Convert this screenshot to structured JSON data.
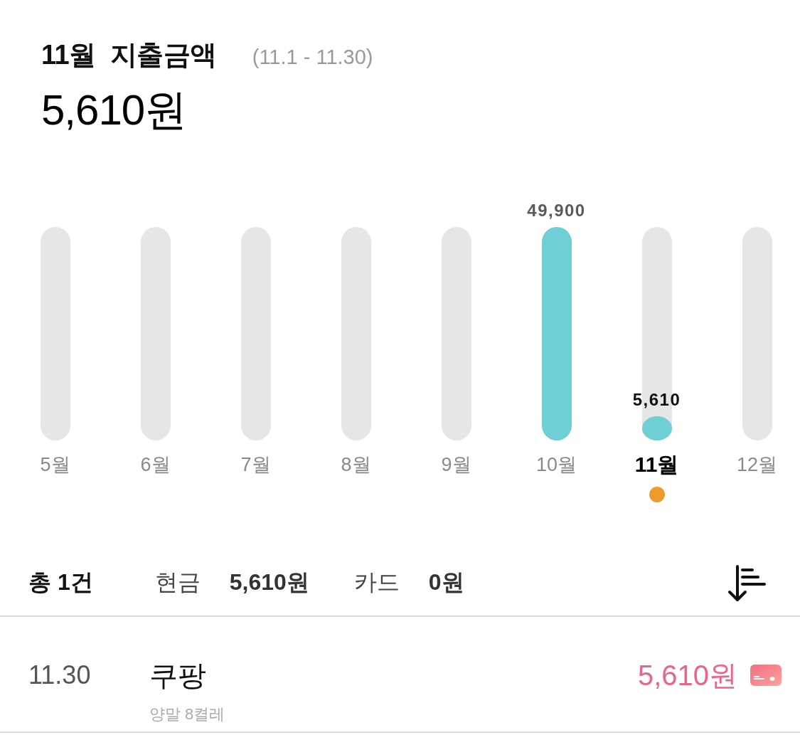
{
  "header": {
    "title": "11월 지출금액",
    "period": "(11.1 - 11.30)",
    "total": "5,610원"
  },
  "months": [
    {
      "label": "5월",
      "selected": false,
      "current": false
    },
    {
      "label": "6월",
      "selected": false,
      "current": false
    },
    {
      "label": "7월",
      "selected": false,
      "current": false
    },
    {
      "label": "8월",
      "selected": false,
      "current": false
    },
    {
      "label": "9월",
      "selected": false,
      "current": false
    },
    {
      "label": "10월",
      "level": 1,
      "value_label": "49,900",
      "selected": false,
      "current": false
    },
    {
      "label": "11월",
      "level": 0.112,
      "value_label": "5,610",
      "selected": true,
      "current": true
    },
    {
      "label": "12월",
      "selected": false,
      "current": false
    }
  ],
  "summary": {
    "count": "총 1건",
    "cash_label": "현금",
    "cash_amount": "5,610원",
    "card_label": "카드",
    "card_amount": "0원"
  },
  "transactions": [
    {
      "date": "11.30",
      "merchant": "쿠팡",
      "memo": "양말 8켤레",
      "amount": "5,610원",
      "kind": "cash"
    }
  ]
}
